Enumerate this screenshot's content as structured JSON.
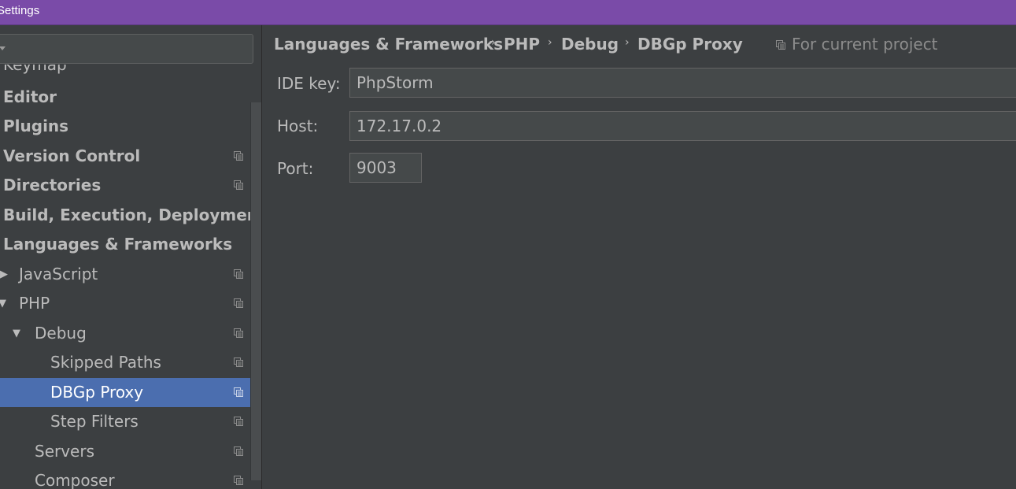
{
  "window": {
    "title": "Settings"
  },
  "sidebar": {
    "cut_item": "Keymap",
    "items": [
      {
        "label": "Editor"
      },
      {
        "label": "Plugins"
      },
      {
        "label": "Version Control"
      },
      {
        "label": "Directories"
      },
      {
        "label": "Build, Execution, Deployment"
      },
      {
        "label": "Languages & Frameworks"
      },
      {
        "label": "JavaScript",
        "arrow": "▶"
      },
      {
        "label": "PHP",
        "arrow": "▼"
      },
      {
        "label": "Debug",
        "arrow": "▼"
      },
      {
        "label": "Skipped Paths"
      },
      {
        "label": "DBGp Proxy",
        "selected": true
      },
      {
        "label": "Step Filters"
      },
      {
        "label": "Servers"
      },
      {
        "label": "Composer"
      }
    ]
  },
  "breadcrumb": {
    "items": [
      "Languages & Frameworks",
      "PHP",
      "Debug",
      "DBGp Proxy"
    ],
    "separator": "›"
  },
  "scope": {
    "label": "For current project",
    "icon": "project-copy-icon"
  },
  "form": {
    "ide_key": {
      "label": "IDE key:",
      "value": "PhpStorm"
    },
    "host": {
      "label": "Host:",
      "value": "172.17.0.2"
    },
    "port": {
      "label": "Port:",
      "value": "9003"
    }
  },
  "colors": {
    "titlebar": "#7a4ba8",
    "background": "#3c3f41",
    "selection": "#4b6eaf",
    "input_background": "#45494a"
  }
}
